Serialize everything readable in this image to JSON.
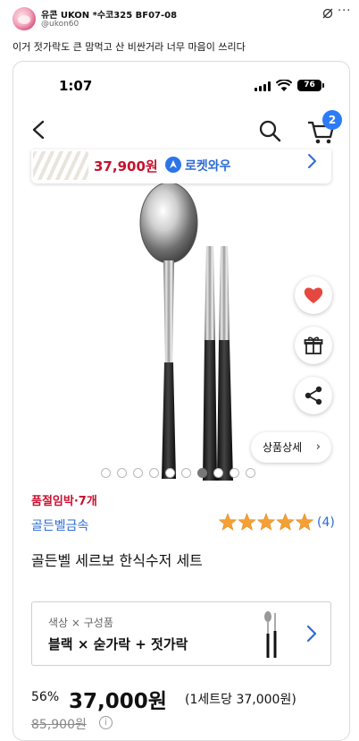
{
  "post": {
    "user_name": "유콘 UKON *수코325 BF07-08",
    "handle": "@ukon60",
    "text": "이거 젓가락도 큰 맘먹고 산 비싼거라 너무 마음이 쓰리다",
    "more_glyph": "···"
  },
  "status_bar": {
    "time": "1:07",
    "battery": "76"
  },
  "nav": {
    "cart_badge": "2"
  },
  "banner": {
    "price": "37,900원",
    "delivery": "로켓와우"
  },
  "product": {
    "urgent": "품절임박·7개",
    "brand": "골든벨금속",
    "rating": 5,
    "review_count": "(4)",
    "title": "골든벨 세르보 한식수저 세트",
    "detail_button": "상품상세",
    "image_count": 10,
    "active_image": 7
  },
  "option": {
    "label": "색상 × 구성품",
    "value": "블랙 × 숟가락 + 젓가락"
  },
  "price": {
    "discount": "56%",
    "sale": "37,000원",
    "unit": "(1세트당 37,000원)",
    "original": "85,900원",
    "info_glyph": "i"
  },
  "colors": {
    "accent_red": "#c8102e",
    "accent_blue": "#2c6bd6",
    "badge_blue": "#2d7cf6",
    "heart_red": "#e5483f",
    "star_orange": "#f5a035"
  },
  "icons": [
    "back-icon",
    "search-icon",
    "cart-icon",
    "heart-icon",
    "gift-icon",
    "share-icon",
    "chevron-right-icon",
    "info-icon"
  ]
}
